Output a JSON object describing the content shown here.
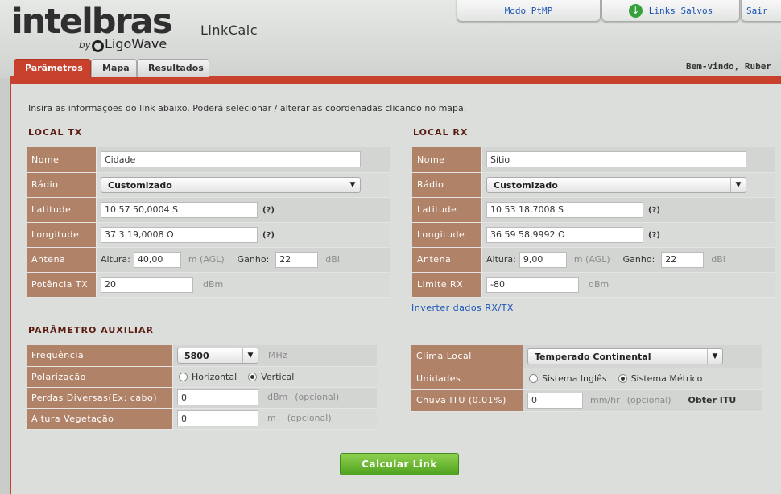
{
  "brand": {
    "logo_text": "intelbras",
    "by": "by",
    "partner": "LigoWave"
  },
  "app_title": "LinkCalc",
  "top_buttons": {
    "ptmp": "Modo PtMP",
    "saved": "Links Salvos",
    "logout": "Sair"
  },
  "tabs": [
    "Parâmetros",
    "Mapa",
    "Resultados"
  ],
  "welcome": "Bem-vindo, Ruber",
  "intro": "Insira as informações do link abaixo. Poderá selecionar / alterar as coordenadas clicando no mapa.",
  "tx": {
    "title": "LOCAL TX",
    "labels": {
      "name": "Nome",
      "radio": "Rádio",
      "lat": "Latitude",
      "lon": "Longitude",
      "antenna": "Antena",
      "power": "Potência TX"
    },
    "name": "Cidade",
    "radio": "Customizado",
    "lat": "10 57 50,0004 S",
    "lon": "37 3 19,0008 O",
    "height_label": "Altura:",
    "height": "40,00",
    "height_unit": "m  (AGL)",
    "gain_label": "Ganho:",
    "gain": "22",
    "gain_unit": "dBi",
    "power": "20",
    "power_unit": "dBm",
    "help": "(?)"
  },
  "rx": {
    "title": "LOCAL RX",
    "labels": {
      "name": "Nome",
      "radio": "Rádio",
      "lat": "Latitude",
      "lon": "Longitude",
      "antenna": "Antena",
      "limit": "Limite RX"
    },
    "name": "Sítio",
    "radio": "Customizado",
    "lat": "10 53 18,7008 S",
    "lon": "36 59 58,9992 O",
    "height_label": "Altura:",
    "height": "9,00",
    "height_unit": "m  (AGL)",
    "gain_label": "Ganho:",
    "gain": "22",
    "gain_unit": "dBi",
    "limit": "-80",
    "limit_unit": "dBm",
    "help": "(?)"
  },
  "invert_link": "Inverter dados RX/TX",
  "aux": {
    "title": "PARÂMETRO AUXILIAR",
    "labels": {
      "freq": "Frequência",
      "pol": "Polarização",
      "loss": "Perdas Diversas(Ex: cabo)",
      "veg": "Altura Vegetação"
    },
    "freq": "5800",
    "freq_unit": "MHz",
    "pol_options": [
      "Horizontal",
      "Vertical"
    ],
    "pol_selected": "Vertical",
    "loss": "0",
    "loss_unit": "dBm",
    "loss_note": "(opcional)",
    "veg": "0",
    "veg_unit": "m",
    "veg_note": "(opcional)"
  },
  "env": {
    "labels": {
      "climate": "Clima Local",
      "units": "Unidades",
      "rain": "Chuva ITU (0.01%)"
    },
    "climate": "Temperado Continental",
    "unit_options": [
      "Sistema Inglês",
      "Sistema Métrico"
    ],
    "unit_selected": "Sistema Métrico",
    "rain": "0",
    "rain_unit": "mm/hr",
    "rain_note": "(opcional)",
    "get_itu": "Obter ITU"
  },
  "calculate": "Calcular Link"
}
